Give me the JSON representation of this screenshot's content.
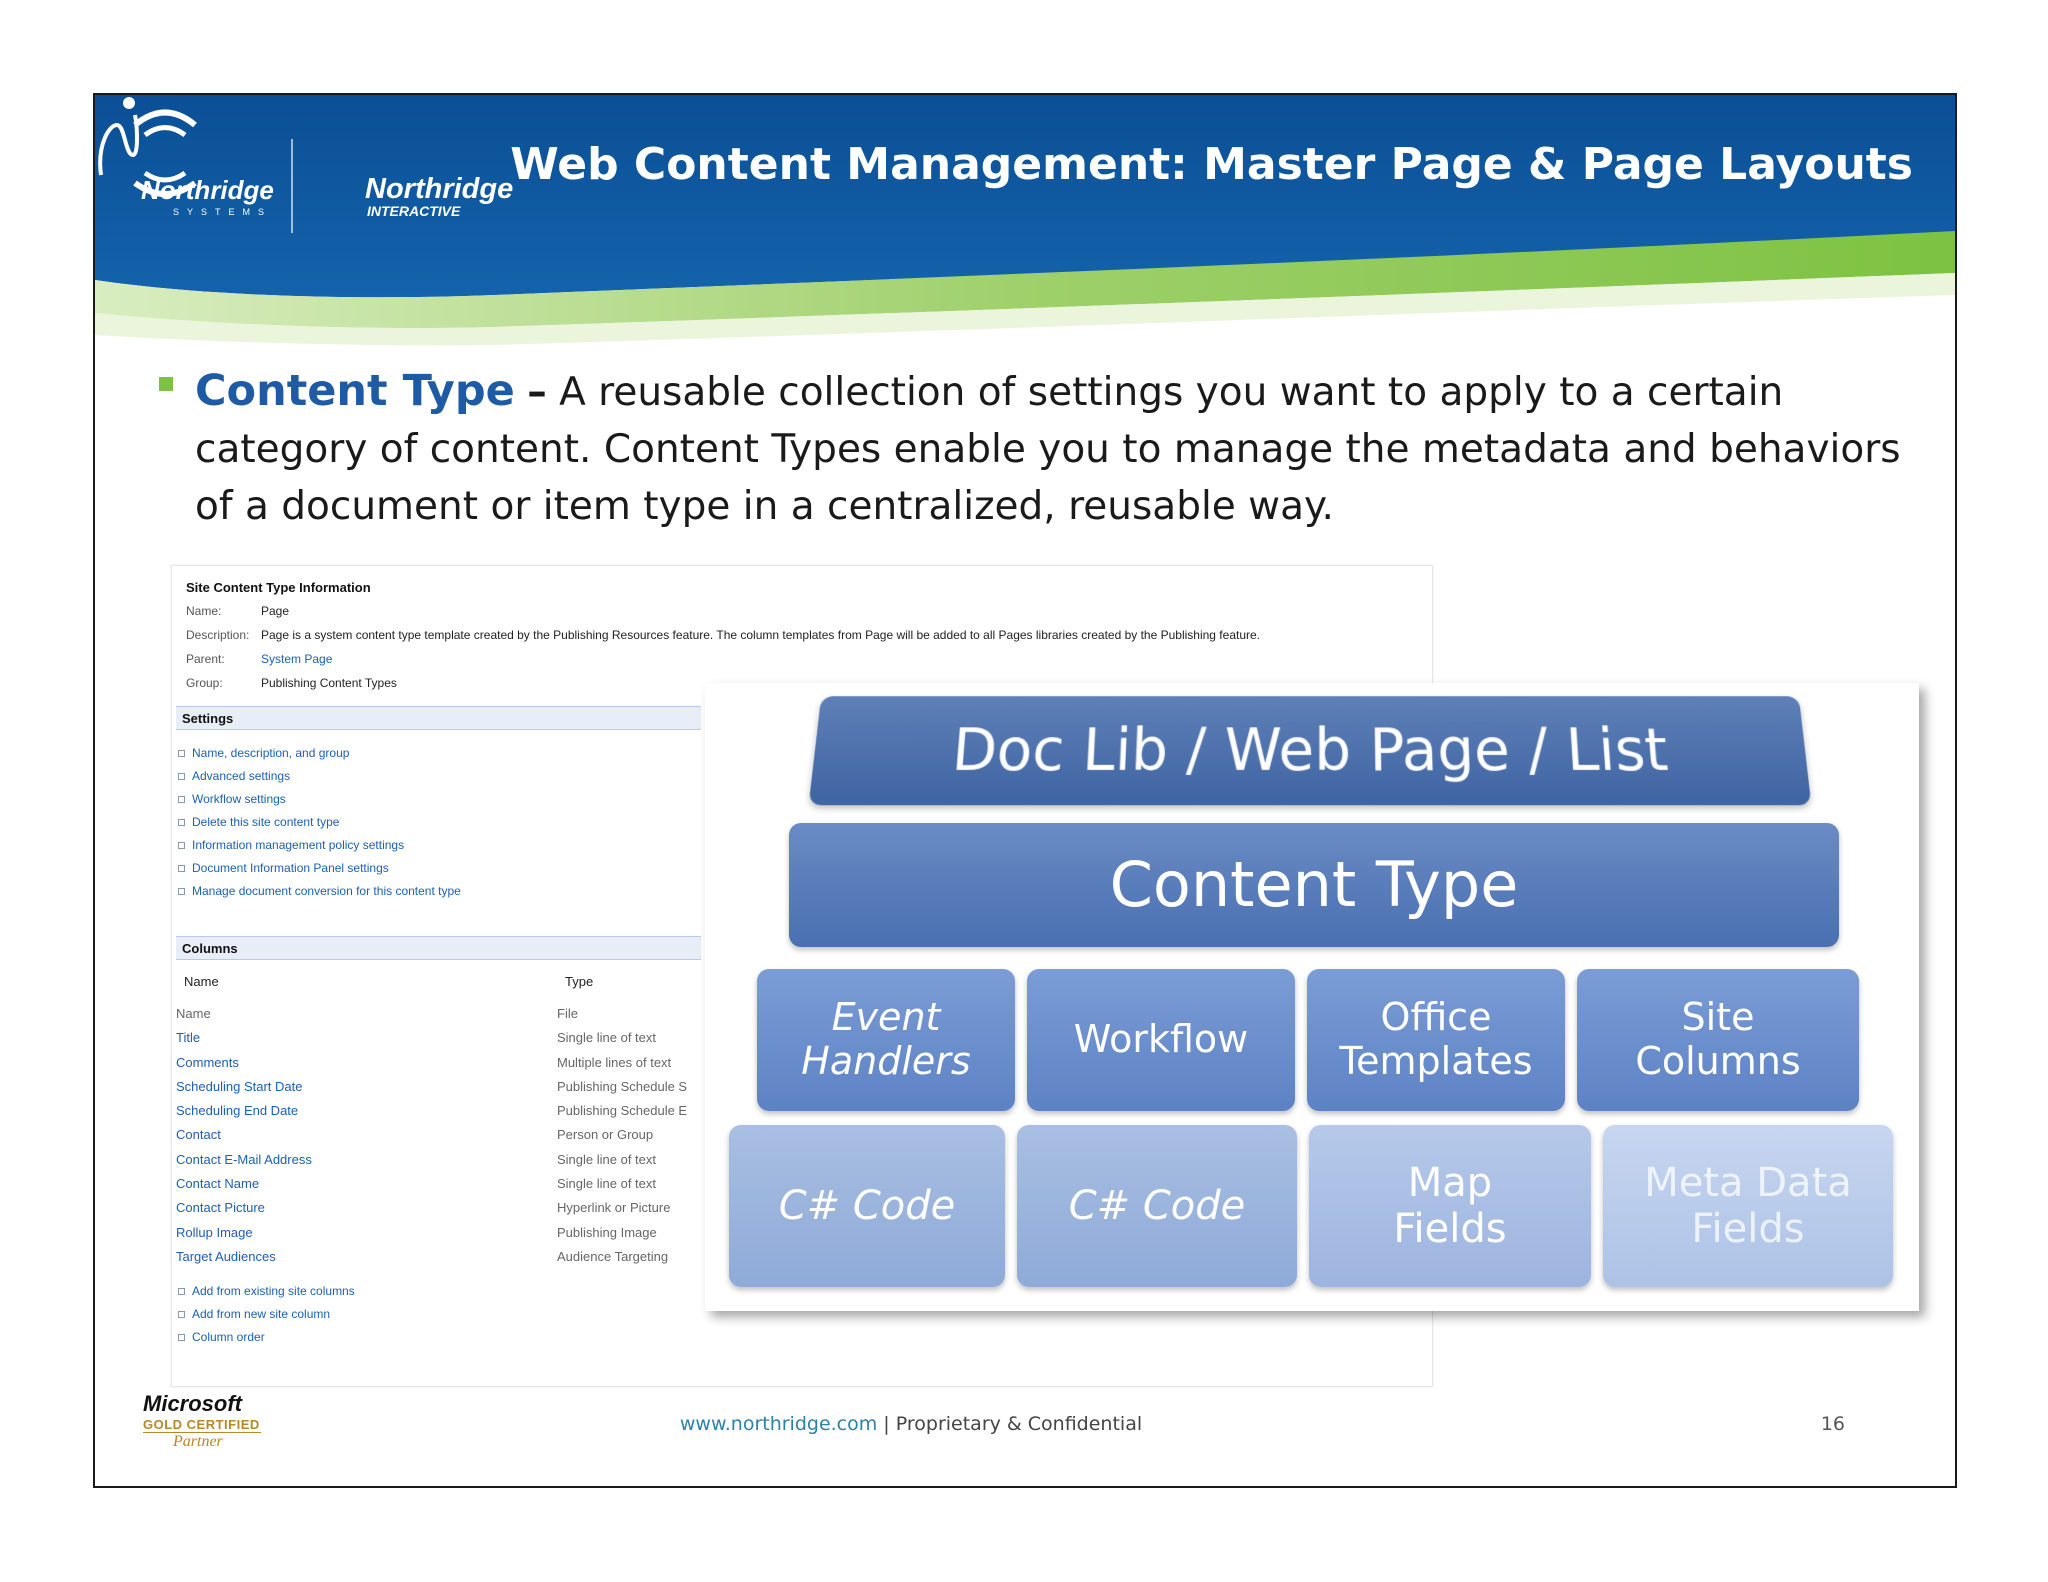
{
  "header": {
    "title": "Web Content Management: Master Page & Page Layouts",
    "logo_left_text": "Northridge",
    "logo_left_sub": "SYSTEMS",
    "logo_right_text": "Northridge",
    "logo_right_sub": "INTERACTIVE"
  },
  "bullet": {
    "term": "Content Type",
    "dash": "–",
    "text": " A reusable collection of settings you want to apply to a certain category of content. Content Types enable you to manage the metadata and behaviors of a document or item type in a centralized, reusable way."
  },
  "sharepoint": {
    "heading": "Site Content Type Information",
    "info": [
      {
        "key": "Name:",
        "value": "Page"
      },
      {
        "key": "Description:",
        "value": "Page is a system content type template created by the Publishing Resources feature. The column templates from Page will be added to all Pages libraries created by the Publishing feature."
      },
      {
        "key": "Parent:",
        "value": "System Page"
      },
      {
        "key": "Group:",
        "value": "Publishing Content Types"
      }
    ],
    "settings_title": "Settings",
    "settings_links": [
      "Name, description, and group",
      "Advanced settings",
      "Workflow settings",
      "Delete this site content type",
      "Information management policy settings",
      "Document Information Panel settings",
      "Manage document conversion for this content type"
    ],
    "columns_title": "Columns",
    "col_header_name": "Name",
    "col_header_type": "Type",
    "columns": [
      {
        "name": "Name",
        "type": "File"
      },
      {
        "name": "Title",
        "type": "Single line of text"
      },
      {
        "name": "Comments",
        "type": "Multiple lines of text"
      },
      {
        "name": "Scheduling Start Date",
        "type": "Publishing Schedule S"
      },
      {
        "name": "Scheduling End Date",
        "type": "Publishing Schedule E"
      },
      {
        "name": "Contact",
        "type": "Person or Group"
      },
      {
        "name": "Contact E-Mail Address",
        "type": "Single line of text"
      },
      {
        "name": "Contact Name",
        "type": "Single line of text"
      },
      {
        "name": "Contact Picture",
        "type": "Hyperlink or Picture"
      },
      {
        "name": "Rollup Image",
        "type": "Publishing Image"
      },
      {
        "name": "Target Audiences",
        "type": "Audience Targeting"
      }
    ],
    "column_links": [
      "Add from existing site columns",
      "Add from new site column",
      "Column order"
    ]
  },
  "stack": {
    "top": "Doc Lib / Web Page / List",
    "content_type": "Content Type",
    "row1": [
      {
        "line1": "Event",
        "line2": "Handlers"
      },
      {
        "line1": "Workflow",
        "line2": ""
      },
      {
        "line1": "Office",
        "line2": "Templates"
      },
      {
        "line1": "Site",
        "line2": "Columns"
      }
    ],
    "row2": [
      {
        "line1": "C# Code",
        "line2": ""
      },
      {
        "line1": "C# Code",
        "line2": ""
      },
      {
        "line1": "Map",
        "line2": "Fields"
      },
      {
        "line1": "Meta Data",
        "line2": "Fields"
      }
    ]
  },
  "badge": {
    "word": "Microsoft",
    "tier": "GOLD CERTIFIED",
    "partner": "Partner"
  },
  "footer": {
    "url": "www.northridge.com",
    "separator": " | ",
    "confidential": "Proprietary & Confidential",
    "page_number": "16"
  },
  "colors": {
    "header_blue": "#0e5aa0",
    "accent_green": "#7dc242",
    "term_blue": "#1f5aa5",
    "footer_link": "#2a83a7"
  }
}
